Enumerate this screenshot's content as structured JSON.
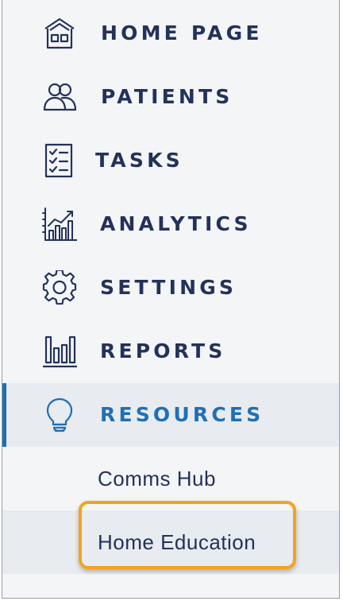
{
  "nav": {
    "items": [
      {
        "label": "HOME PAGE",
        "icon": "house-icon"
      },
      {
        "label": "PATIENTS",
        "icon": "patients-icon"
      },
      {
        "label": "TASKS",
        "icon": "task-list-icon"
      },
      {
        "label": "ANALYTICS",
        "icon": "analytics-chart-icon"
      },
      {
        "label": "SETTINGS",
        "icon": "gear-icon"
      },
      {
        "label": "REPORTS",
        "icon": "bar-chart-icon"
      },
      {
        "label": "RESOURCES",
        "icon": "lightbulb-icon",
        "active": true
      }
    ],
    "sub_items": [
      {
        "label": "Comms Hub"
      },
      {
        "label": "Home Education",
        "highlighted": true
      }
    ]
  },
  "colors": {
    "text": "#23325a",
    "accent": "#1f6fb5",
    "highlight": "#f4a21f",
    "active_bg": "#e8ebef",
    "panel_bg": "#f4f5f7"
  }
}
